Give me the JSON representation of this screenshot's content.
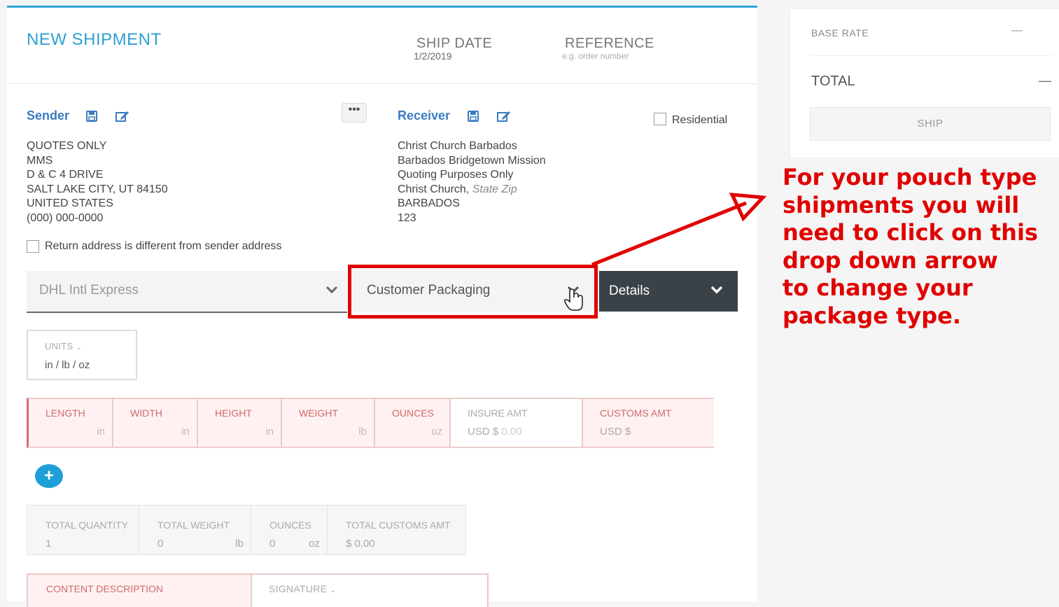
{
  "header": {
    "title": "NEW SHIPMENT",
    "ship_date_label": "SHIP DATE",
    "ship_date_value": "1/2/2019",
    "reference_label": "REFERENCE",
    "reference_placeholder": "e.g. order number"
  },
  "sender": {
    "label": "Sender",
    "address_lines": [
      "QUOTES ONLY",
      "MMS",
      "D & C 4 DRIVE",
      "SALT LAKE CITY, UT 84150",
      "UNITED STATES",
      "(000) 000-0000"
    ]
  },
  "ellipsis_label": "•••",
  "receiver": {
    "label": "Receiver",
    "residential_label": "Residential",
    "address_lines": [
      "Christ Church Barbados",
      "Barbados Bridgetown Mission",
      "Quoting Purposes Only",
      "Christ Church,",
      "BARBADOS",
      "123"
    ],
    "state_zip_placeholder": "State Zip"
  },
  "return_address_label": "Return address is different from sender address",
  "carrier_select": {
    "value": "DHL Intl Express"
  },
  "packaging_select": {
    "value": "Customer Packaging"
  },
  "details_button": {
    "label": "Details"
  },
  "units": {
    "label": "UNITS",
    "value": "in / lb / oz"
  },
  "dimensions": {
    "length": {
      "label": "LENGTH",
      "unit": "in"
    },
    "width": {
      "label": "WIDTH",
      "unit": "in"
    },
    "height": {
      "label": "HEIGHT",
      "unit": "in"
    },
    "weight": {
      "label": "WEIGHT",
      "unit": "lb"
    },
    "ounces": {
      "label": "OUNCES",
      "unit": "oz"
    },
    "insure": {
      "label": "INSURE AMT",
      "prefix": "USD $",
      "placeholder": "0.00"
    },
    "customs": {
      "label": "CUSTOMS AMT",
      "prefix": "USD $"
    }
  },
  "add_button": {
    "label": "+"
  },
  "totals": {
    "quantity": {
      "label": "TOTAL QUANTITY",
      "value": "1"
    },
    "weight": {
      "label": "TOTAL WEIGHT",
      "value": "0",
      "unit": "lb"
    },
    "ounces": {
      "label": "OUNCES",
      "value": "0",
      "unit": "oz"
    },
    "customs": {
      "label": "TOTAL CUSTOMS AMT",
      "value": "$ 0.00"
    }
  },
  "content_description": {
    "label": "CONTENT DESCRIPTION"
  },
  "signature": {
    "label": "SIGNATURE"
  },
  "summary": {
    "base_rate_label": "BASE RATE",
    "base_rate_value": "—",
    "total_label": "TOTAL",
    "total_value": "—",
    "ship_label": "SHIP"
  },
  "annotation": {
    "lines": [
      "For your pouch type",
      "shipments you will",
      "need to click on this",
      "drop down arrow",
      "to change your",
      "package type."
    ]
  },
  "colors": {
    "accent": "#2f9fd3",
    "annotation": "#e00000",
    "details_bg": "#3a4248",
    "dim_label": "#d06a6a"
  }
}
